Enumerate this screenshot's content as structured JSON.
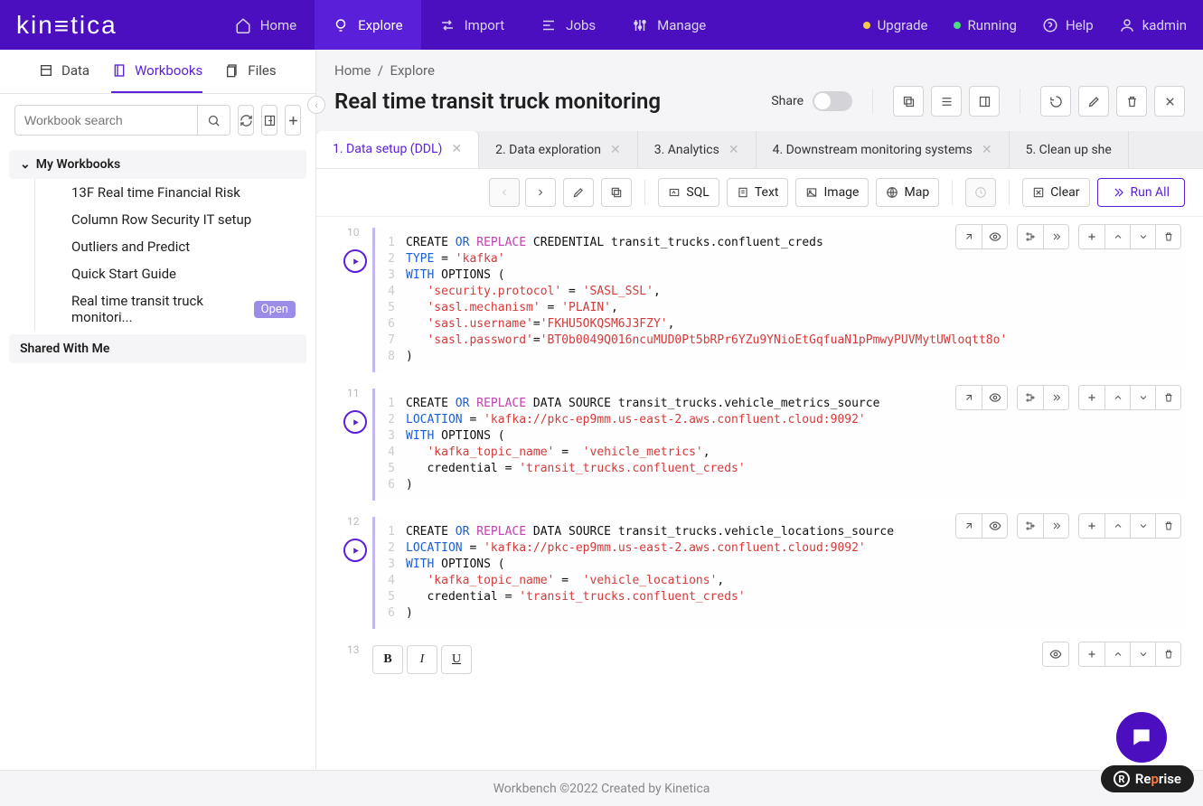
{
  "brand": "kinetica",
  "nav": {
    "home": "Home",
    "explore": "Explore",
    "import": "Import",
    "jobs": "Jobs",
    "manage": "Manage",
    "upgrade": "Upgrade",
    "running": "Running",
    "help": "Help",
    "user": "kadmin"
  },
  "sidebar": {
    "tabs": {
      "data": "Data",
      "workbooks": "Workbooks",
      "files": "Files"
    },
    "search_placeholder": "Workbook search",
    "my_workbooks": "My Workbooks",
    "shared": "Shared With Me",
    "items": [
      {
        "label": "13F Real time Financial Risk"
      },
      {
        "label": "Column Row Security IT setup"
      },
      {
        "label": "Outliers and Predict"
      },
      {
        "label": "Quick Start Guide"
      },
      {
        "label": "Real time transit truck monitori...",
        "badge": "Open"
      }
    ]
  },
  "breadcrumb": {
    "home": "Home",
    "explore": "Explore"
  },
  "title": "Real time transit truck monitoring",
  "share_label": "Share",
  "tabs": [
    {
      "label": "1. Data setup (DDL)",
      "active": true
    },
    {
      "label": "2. Data exploration"
    },
    {
      "label": "3. Analytics"
    },
    {
      "label": "4. Downstream monitoring systems"
    },
    {
      "label": "5. Clean up she"
    }
  ],
  "toolbar": {
    "sql": "SQL",
    "text": "Text",
    "image": "Image",
    "map": "Map",
    "clear": "Clear",
    "run_all": "Run All"
  },
  "blocks": [
    {
      "num": "10",
      "lines": [
        [
          {
            "t": "CREATE ",
            "c": "plain"
          },
          {
            "t": "OR",
            "c": "or"
          },
          {
            "t": " ",
            "c": "plain"
          },
          {
            "t": "REPLACE",
            "c": "rep"
          },
          {
            "t": " CREDENTIAL transit_trucks.confluent_creds",
            "c": "plain"
          }
        ],
        [
          {
            "t": "TYPE",
            "c": "kw"
          },
          {
            "t": " = ",
            "c": "plain"
          },
          {
            "t": "'kafka'",
            "c": "str"
          }
        ],
        [
          {
            "t": "WITH",
            "c": "kw"
          },
          {
            "t": " OPTIONS (",
            "c": "plain"
          }
        ],
        [
          {
            "t": "   ",
            "c": "plain"
          },
          {
            "t": "'security.protocol'",
            "c": "str"
          },
          {
            "t": " = ",
            "c": "plain"
          },
          {
            "t": "'SASL_SSL'",
            "c": "str"
          },
          {
            "t": ",",
            "c": "plain"
          }
        ],
        [
          {
            "t": "   ",
            "c": "plain"
          },
          {
            "t": "'sasl.mechanism'",
            "c": "str"
          },
          {
            "t": " = ",
            "c": "plain"
          },
          {
            "t": "'PLAIN'",
            "c": "str"
          },
          {
            "t": ",",
            "c": "plain"
          }
        ],
        [
          {
            "t": "   ",
            "c": "plain"
          },
          {
            "t": "'sasl.username'",
            "c": "str"
          },
          {
            "t": "=",
            "c": "plain"
          },
          {
            "t": "'FKHU5OKQSM6J3FZY'",
            "c": "str"
          },
          {
            "t": ",",
            "c": "plain"
          }
        ],
        [
          {
            "t": "   ",
            "c": "plain"
          },
          {
            "t": "'sasl.password'",
            "c": "str"
          },
          {
            "t": "=",
            "c": "plain"
          },
          {
            "t": "'BT0b0049Q016ncuMUD0Pt5bRPr6YZu9YNioEtGqfuaN1pPmwyPUVMytUWloqtt8o'",
            "c": "str"
          }
        ],
        [
          {
            "t": ")",
            "c": "plain"
          }
        ]
      ]
    },
    {
      "num": "11",
      "lines": [
        [
          {
            "t": "CREATE ",
            "c": "plain"
          },
          {
            "t": "OR",
            "c": "or"
          },
          {
            "t": " ",
            "c": "plain"
          },
          {
            "t": "REPLACE",
            "c": "rep"
          },
          {
            "t": " DATA SOURCE transit_trucks.vehicle_metrics_source",
            "c": "plain"
          }
        ],
        [
          {
            "t": "LOCATION",
            "c": "kw"
          },
          {
            "t": " = ",
            "c": "plain"
          },
          {
            "t": "'kafka://pkc-ep9mm.us-east-2.aws.confluent.cloud:9092'",
            "c": "str"
          }
        ],
        [
          {
            "t": "WITH",
            "c": "kw"
          },
          {
            "t": " OPTIONS (",
            "c": "plain"
          }
        ],
        [
          {
            "t": "   ",
            "c": "plain"
          },
          {
            "t": "'kafka_topic_name'",
            "c": "str"
          },
          {
            "t": " =  ",
            "c": "plain"
          },
          {
            "t": "'vehicle_metrics'",
            "c": "str"
          },
          {
            "t": ",",
            "c": "plain"
          }
        ],
        [
          {
            "t": "   credential = ",
            "c": "plain"
          },
          {
            "t": "'transit_trucks.confluent_creds'",
            "c": "str"
          }
        ],
        [
          {
            "t": ")",
            "c": "plain"
          }
        ]
      ]
    },
    {
      "num": "12",
      "lines": [
        [
          {
            "t": "CREATE ",
            "c": "plain"
          },
          {
            "t": "OR",
            "c": "or"
          },
          {
            "t": " ",
            "c": "plain"
          },
          {
            "t": "REPLACE",
            "c": "rep"
          },
          {
            "t": " DATA SOURCE transit_trucks.vehicle_locations_source",
            "c": "plain"
          }
        ],
        [
          {
            "t": "LOCATION",
            "c": "kw"
          },
          {
            "t": " = ",
            "c": "plain"
          },
          {
            "t": "'kafka://pkc-ep9mm.us-east-2.aws.confluent.cloud:9092'",
            "c": "str"
          }
        ],
        [
          {
            "t": "WITH",
            "c": "kw"
          },
          {
            "t": " OPTIONS (",
            "c": "plain"
          }
        ],
        [
          {
            "t": "   ",
            "c": "plain"
          },
          {
            "t": "'kafka_topic_name'",
            "c": "str"
          },
          {
            "t": " =  ",
            "c": "plain"
          },
          {
            "t": "'vehicle_locations'",
            "c": "str"
          },
          {
            "t": ",",
            "c": "plain"
          }
        ],
        [
          {
            "t": "   credential = ",
            "c": "plain"
          },
          {
            "t": "'transit_trucks.confluent_creds'",
            "c": "str"
          }
        ],
        [
          {
            "t": ")",
            "c": "plain"
          }
        ]
      ]
    }
  ],
  "block13_num": "13",
  "footer": "Workbench ©2022 Created by Kinetica",
  "reprise": "Reprise"
}
